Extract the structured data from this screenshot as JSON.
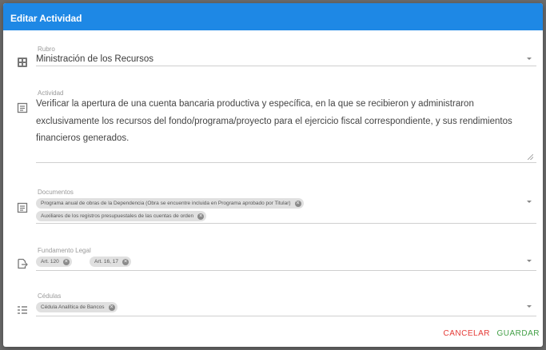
{
  "dialog": {
    "title": "Editar Actividad"
  },
  "rubro": {
    "label": "Rubro",
    "value": "Ministración de los Recursos",
    "icon": "table-icon"
  },
  "actividad": {
    "label": "Actividad",
    "lines": [
      "Verificar la apertura de una cuenta bancaria productiva y específica, en la que se recibieron y administraron",
      "exclusivamente los recursos del fondo/programa/proyecto para el ejercicio fiscal correspondiente, y sus rendimientos",
      "financieros generados."
    ],
    "icon": "document-icon"
  },
  "documentos": {
    "label": "Documentos",
    "chips": [
      "Programa anual de obras de la Dependencia (Obra se encuentre incluida en Programa aprobado por Titular)",
      "Auxiliares de los registros presupuestales de las cuentas de orden"
    ],
    "icon": "document-icon"
  },
  "fundamento": {
    "label": "Fundamento Legal",
    "chips": [
      "Art. 120",
      "Art. 16, 17"
    ],
    "icon": "file-export-icon"
  },
  "cedulas": {
    "label": "Cédulas",
    "chips": [
      "Cédula Analítica de Bancos"
    ],
    "icon": "list-icon"
  },
  "actions": {
    "cancel_label": "CANCELAR",
    "save_label": "GUARDAR"
  },
  "colors": {
    "header": "#1e88e5",
    "cancel": "#e53935",
    "save": "#43a047"
  }
}
